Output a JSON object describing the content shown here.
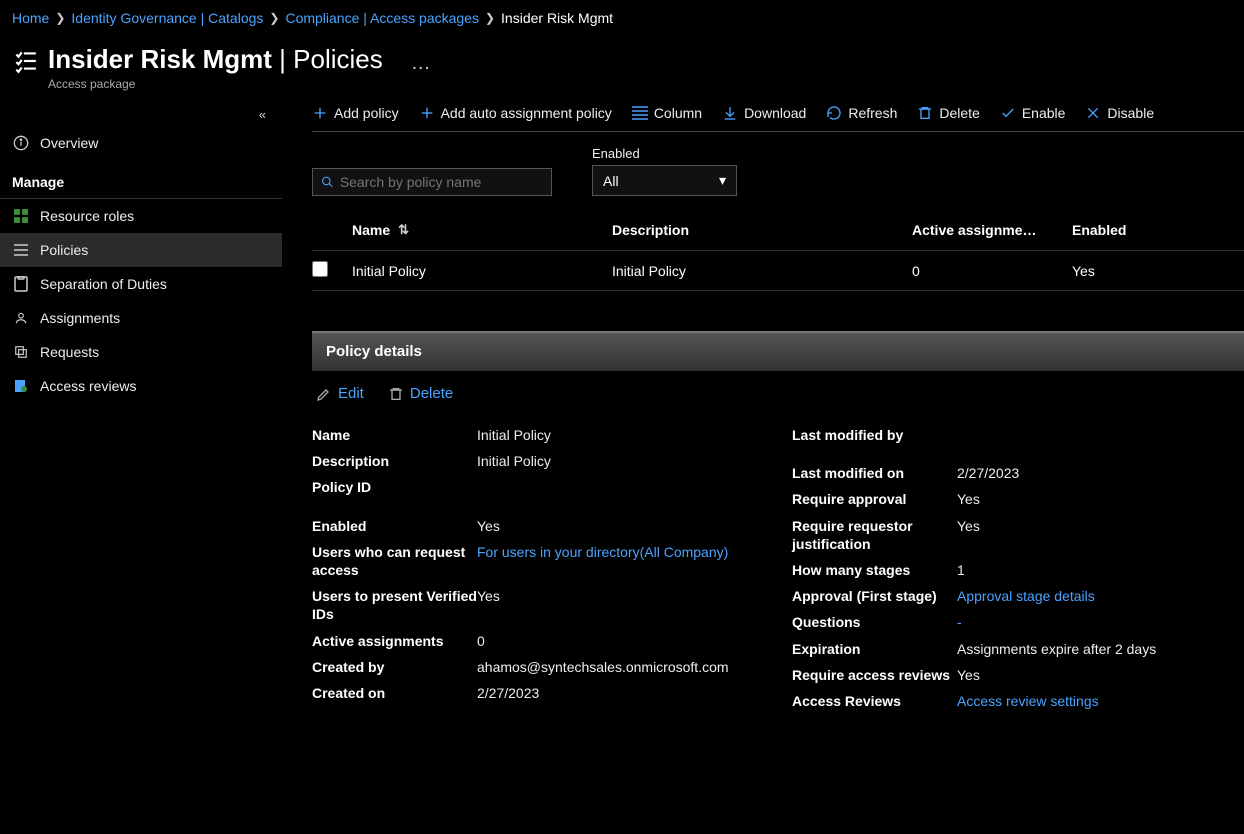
{
  "breadcrumb": {
    "items": [
      {
        "label": "Home"
      },
      {
        "label": "Identity Governance | Catalogs"
      },
      {
        "label": "Compliance | Access packages"
      }
    ],
    "current": "Insider Risk Mgmt"
  },
  "header": {
    "title_main": "Insider Risk Mgmt",
    "title_section": "Policies",
    "subtitle": "Access package"
  },
  "sidebar": {
    "overview": "Overview",
    "manage_header": "Manage",
    "items": [
      {
        "label": "Resource roles"
      },
      {
        "label": "Policies"
      },
      {
        "label": "Separation of Duties"
      },
      {
        "label": "Assignments"
      },
      {
        "label": "Requests"
      },
      {
        "label": "Access reviews"
      }
    ]
  },
  "toolbar": {
    "add_policy": "Add policy",
    "add_auto": "Add auto assignment policy",
    "column": "Column",
    "download": "Download",
    "refresh": "Refresh",
    "delete": "Delete",
    "enable": "Enable",
    "disable": "Disable"
  },
  "filters": {
    "search_placeholder": "Search by policy name",
    "enabled_label": "Enabled",
    "enabled_value": "All"
  },
  "grid": {
    "headers": {
      "name": "Name",
      "description": "Description",
      "active_assignments": "Active assignme…",
      "enabled": "Enabled"
    },
    "rows": [
      {
        "name": "Initial Policy",
        "description": "Initial Policy",
        "active_assignments": "0",
        "enabled": "Yes"
      }
    ]
  },
  "panel": {
    "title": "Policy details",
    "edit": "Edit",
    "delete": "Delete",
    "fields_left": {
      "name": {
        "label": "Name",
        "value": "Initial Policy"
      },
      "description": {
        "label": "Description",
        "value": "Initial Policy"
      },
      "policy_id": {
        "label": "Policy ID",
        "value": ""
      },
      "enabled": {
        "label": "Enabled",
        "value": "Yes"
      },
      "users_request": {
        "label": "Users who can request access",
        "value": "For users in your directory(All Company)"
      },
      "users_verified": {
        "label": "Users to present Verified IDs",
        "value": "Yes"
      },
      "active_assignments": {
        "label": "Active assignments",
        "value": "0"
      },
      "created_by": {
        "label": "Created by",
        "value": "ahamos@syntechsales.onmicrosoft.com"
      },
      "created_on": {
        "label": "Created on",
        "value": "2/27/2023"
      }
    },
    "fields_right": {
      "last_modified_by": {
        "label": "Last modified by",
        "value": ""
      },
      "last_modified_on": {
        "label": "Last modified on",
        "value": "2/27/2023"
      },
      "require_approval": {
        "label": "Require approval",
        "value": "Yes"
      },
      "require_requestor_justification": {
        "label": "Require requestor justification",
        "value": "Yes"
      },
      "how_many_stages": {
        "label": "How many stages",
        "value": "1"
      },
      "approval_first_stage": {
        "label": "Approval (First stage)",
        "value": "Approval stage details"
      },
      "questions": {
        "label": "Questions",
        "value": "-"
      },
      "expiration": {
        "label": "Expiration",
        "value": "Assignments expire after 2 days"
      },
      "require_access_reviews": {
        "label": "Require access reviews",
        "value": "Yes"
      },
      "access_reviews": {
        "label": "Access Reviews",
        "value": "Access review settings"
      }
    }
  }
}
